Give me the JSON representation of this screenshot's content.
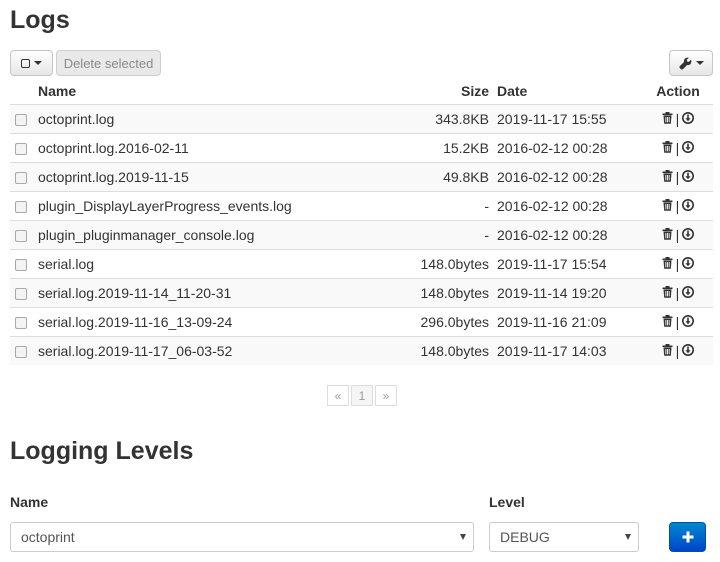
{
  "logs": {
    "title": "Logs",
    "toolbar": {
      "select_icon": "checkbox-square-icon",
      "delete_label": "Delete selected",
      "settings_icon": "wrench-icon"
    },
    "columns": {
      "name": "Name",
      "size": "Size",
      "date": "Date",
      "action": "Action"
    },
    "rows": [
      {
        "name": "octoprint.log",
        "size": "343.8KB",
        "date": "2019-11-17 15:55"
      },
      {
        "name": "octoprint.log.2016-02-11",
        "size": "15.2KB",
        "date": "2016-02-12 00:28"
      },
      {
        "name": "octoprint.log.2019-11-15",
        "size": "49.8KB",
        "date": "2016-02-12 00:28"
      },
      {
        "name": "plugin_DisplayLayerProgress_events.log",
        "size": "-",
        "date": "2016-02-12 00:28"
      },
      {
        "name": "plugin_pluginmanager_console.log",
        "size": "-",
        "date": "2016-02-12 00:28"
      },
      {
        "name": "serial.log",
        "size": "148.0bytes",
        "date": "2019-11-17 15:54"
      },
      {
        "name": "serial.log.2019-11-14_11-20-31",
        "size": "148.0bytes",
        "date": "2019-11-14 19:20"
      },
      {
        "name": "serial.log.2019-11-16_13-09-24",
        "size": "296.0bytes",
        "date": "2019-11-16 21:09"
      },
      {
        "name": "serial.log.2019-11-17_06-03-52",
        "size": "148.0bytes",
        "date": "2019-11-17 14:03"
      }
    ],
    "action_separator": "|",
    "pagination": {
      "prev": "«",
      "page": "1",
      "next": "»"
    }
  },
  "logging_levels": {
    "title": "Logging Levels",
    "name_label": "Name",
    "level_label": "Level",
    "name_value": "octoprint",
    "level_value": "DEBUG",
    "add_icon": "plus-icon"
  },
  "colors": {
    "primary": "#0055cc",
    "row_stripe": "#f9f9f9",
    "border": "#dddddd"
  }
}
